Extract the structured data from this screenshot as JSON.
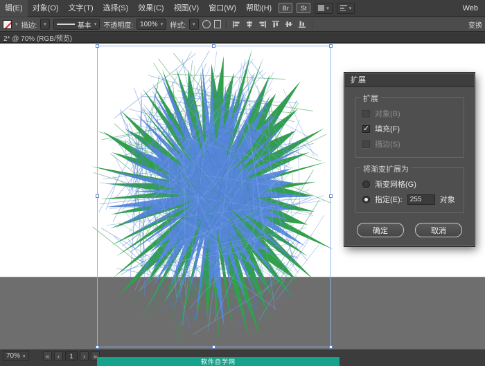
{
  "menu": {
    "items": [
      "辑(E)",
      "对象(O)",
      "文字(T)",
      "选择(S)",
      "效果(C)",
      "视图(V)",
      "窗口(W)",
      "帮助(H)"
    ]
  },
  "app": {
    "br": "Br",
    "st": "St",
    "workspace": "Web"
  },
  "toolbar": {
    "stroke_label": "描边:",
    "profile_value": "基本",
    "opacity_label": "不透明度:",
    "opacity_value": "100%",
    "style_label": "样式:",
    "transform_label": "变换"
  },
  "document_tab": {
    "title": "2* @ 70% (RGB/预览)"
  },
  "dialog": {
    "title": "扩展",
    "group_expand": {
      "label": "扩展",
      "object_label": "对象(B)",
      "fill_label": "填充(F)",
      "stroke_label": "描边(S)"
    },
    "group_gradient": {
      "label": "将渐变扩展为",
      "mesh_label": "渐变网格(G)",
      "specify_label": "指定(E):",
      "value": "255",
      "suffix": "对象"
    },
    "ok_label": "确定",
    "cancel_label": "取消"
  },
  "statusbar": {
    "zoom_value": "70%",
    "artboard_value": "1"
  },
  "footer": {
    "banner_text": "软件自学网"
  },
  "colors": {
    "artwork_green": "#31a04a",
    "artwork_blue": "#5586dc",
    "blue_chords": [
      "#7da2ec",
      "#5d87df",
      "#4b77d2"
    ],
    "green_chord": "#2e9b47",
    "selection": "#8fb4e8",
    "banner": "#17a28b"
  }
}
